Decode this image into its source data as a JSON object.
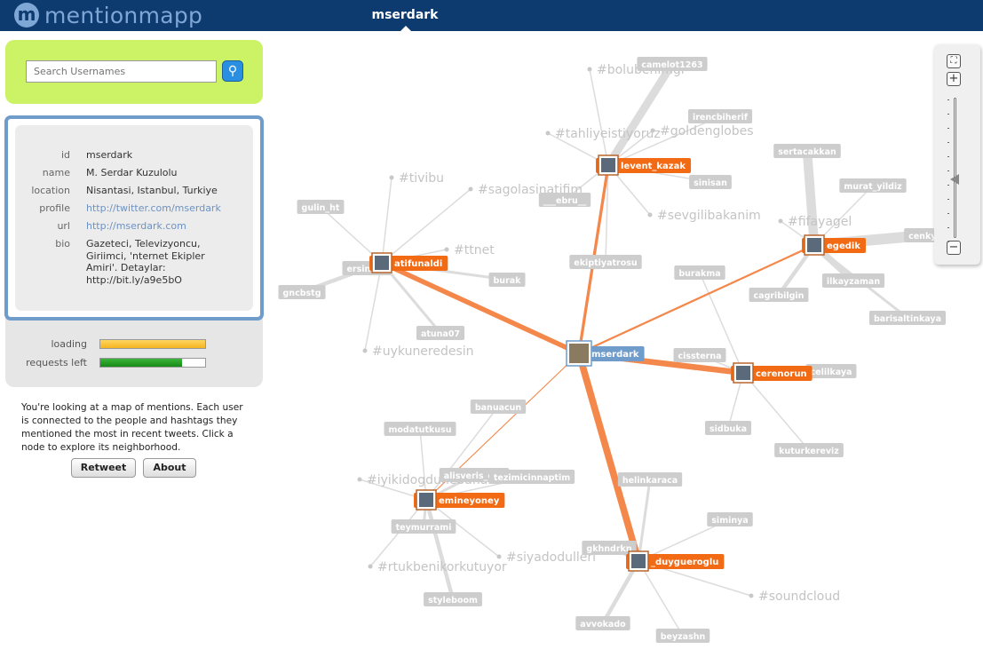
{
  "app": {
    "name": "mentionmapp",
    "logo_letter": "m",
    "current_user": "mserdark",
    "brand_color": "#0d3a6f",
    "accent_hub": "#f26a13",
    "center_color": "#6f9ccb"
  },
  "search": {
    "placeholder": "Search Usernames",
    "icon": "search-icon"
  },
  "profile": {
    "labels": {
      "id": "id",
      "name": "name",
      "location": "location",
      "profile": "profile",
      "url": "url",
      "bio": "bio"
    },
    "id": "mserdark",
    "name": "M. Serdar Kuzulolu",
    "location": "Nisantasi, Istanbul, Turkiye",
    "profile": "http://twitter.com/mserdark",
    "url": "http://mserdark.com",
    "bio": "Gazeteci, Televizyoncu, Giriimci, 'nternet Ekipler Amiri'. Detaylar: http://bit.ly/a9e5bO"
  },
  "status": {
    "loading_label": "loading",
    "loading_progress": 1.0,
    "requests_label": "requests left",
    "requests_left": 0.78
  },
  "description": "You're looking at a map of mentions. Each user is connected to the people and hashtags they mentioned the most in recent tweets. Click a node to explore its neighborhood.",
  "buttons": {
    "retweet": "Retweet",
    "about": "About"
  },
  "zoom": {
    "fit_icon": "fullscreen-icon",
    "in_icon": "plus-icon",
    "out_icon": "minus-icon",
    "level": 0.58
  },
  "graph": {
    "hubs": [
      "mserdark",
      "levent_kazak",
      "atifunaldi",
      "egedik",
      "cerenorun",
      "emineyoney",
      "_duygueroglu"
    ],
    "center": "mserdark",
    "users": [
      "camelot1263",
      "irencbiherif",
      "sinisan",
      "___ebru__",
      "ekiptiyatrosu",
      "burakma",
      "gulin_ht",
      "ersinkoc",
      "gncbstg",
      "burak",
      "atuna07",
      "sertacakkan",
      "murat_yildiz",
      "cenkya",
      "ilkayzaman",
      "cagribilgin",
      "barisaltinkaya",
      "cissterna",
      "celilkaya",
      "sidbuka",
      "kuturkereviz",
      "banuacun",
      "modatutkusu",
      "alisveris_cini",
      "tezimicinnaptim",
      "helinkaraca",
      "teymurrami",
      "siminya",
      "gkhndrkn",
      "styleboom",
      "avvokado",
      "beyzashn"
    ],
    "hashtags": [
      "#bolubenimgi",
      "#tahliyeistiyoruz",
      "#goldenglobes",
      "#tivibu",
      "#sagolasinatifim",
      "#sevgilibakanim",
      "#ttnet",
      "#uykuneredesin",
      "#fifayagel",
      "#iyikidogdunebahar",
      "#rtukbenikorkutuyor",
      "#siyadodulleri",
      "#soundcloud"
    ],
    "edges": [
      [
        "mserdark",
        "atifunaldi",
        5
      ],
      [
        "mserdark",
        "levent_kazak",
        3
      ],
      [
        "mserdark",
        "egedik",
        2
      ],
      [
        "mserdark",
        "cerenorun",
        6
      ],
      [
        "mserdark",
        "emineyoney",
        1
      ],
      [
        "mserdark",
        "_duygueroglu",
        7
      ],
      [
        "levent_kazak",
        "camelot1263",
        6
      ],
      [
        "levent_kazak",
        "#bolubenimgi",
        1
      ],
      [
        "levent_kazak",
        "#tahliyeistiyoruz",
        1
      ],
      [
        "levent_kazak",
        "#goldenglobes",
        1
      ],
      [
        "levent_kazak",
        "irencbiherif",
        1
      ],
      [
        "levent_kazak",
        "sinisan",
        1
      ],
      [
        "levent_kazak",
        "___ebru__",
        1
      ],
      [
        "levent_kazak",
        "ekiptiyatrosu",
        1
      ],
      [
        "levent_kazak",
        "#sevgilibakanim",
        1
      ],
      [
        "atifunaldi",
        "gulin_ht",
        1
      ],
      [
        "atifunaldi",
        "#tivibu",
        1
      ],
      [
        "atifunaldi",
        "#sagolasinatifim",
        1
      ],
      [
        "atifunaldi",
        "#ttnet",
        1
      ],
      [
        "atifunaldi",
        "burak",
        2
      ],
      [
        "atifunaldi",
        "ersinkoc",
        2
      ],
      [
        "atifunaldi",
        "gncbstg",
        3
      ],
      [
        "atifunaldi",
        "atuna07",
        2
      ],
      [
        "atifunaldi",
        "#uykuneredesin",
        1
      ],
      [
        "egedik",
        "sertacakkan",
        7
      ],
      [
        "egedik",
        "murat_yildiz",
        1
      ],
      [
        "egedik",
        "#fifayagel",
        1
      ],
      [
        "egedik",
        "cenkya",
        8
      ],
      [
        "egedik",
        "ilkayzaman",
        5
      ],
      [
        "egedik",
        "cagribilgin",
        3
      ],
      [
        "egedik",
        "barisaltinkaya",
        2
      ],
      [
        "cerenorun",
        "cissterna",
        1
      ],
      [
        "cerenorun",
        "celilkaya",
        1
      ],
      [
        "cerenorun",
        "sidbuka",
        1
      ],
      [
        "cerenorun",
        "kuturkereviz",
        1
      ],
      [
        "cerenorun",
        "burakma",
        1
      ],
      [
        "emineyoney",
        "banuacun",
        1
      ],
      [
        "emineyoney",
        "modatutkusu",
        1
      ],
      [
        "emineyoney",
        "alisveris_cini",
        2
      ],
      [
        "emineyoney",
        "tezimicinnaptim",
        1
      ],
      [
        "emineyoney",
        "#iyikidogdunebahar",
        1
      ],
      [
        "emineyoney",
        "teymurrami",
        2
      ],
      [
        "emineyoney",
        "#rtukbenikorkutuyor",
        1
      ],
      [
        "emineyoney",
        "#siyadodulleri",
        1
      ],
      [
        "emineyoney",
        "styleboom",
        3
      ],
      [
        "_duygueroglu",
        "helinkaraca",
        2
      ],
      [
        "_duygueroglu",
        "siminya",
        1
      ],
      [
        "_duygueroglu",
        "gkhndrkn",
        1
      ],
      [
        "_duygueroglu",
        "#soundcloud",
        1
      ],
      [
        "_duygueroglu",
        "avvokado",
        3
      ],
      [
        "_duygueroglu",
        "beyzashn",
        1
      ]
    ]
  }
}
